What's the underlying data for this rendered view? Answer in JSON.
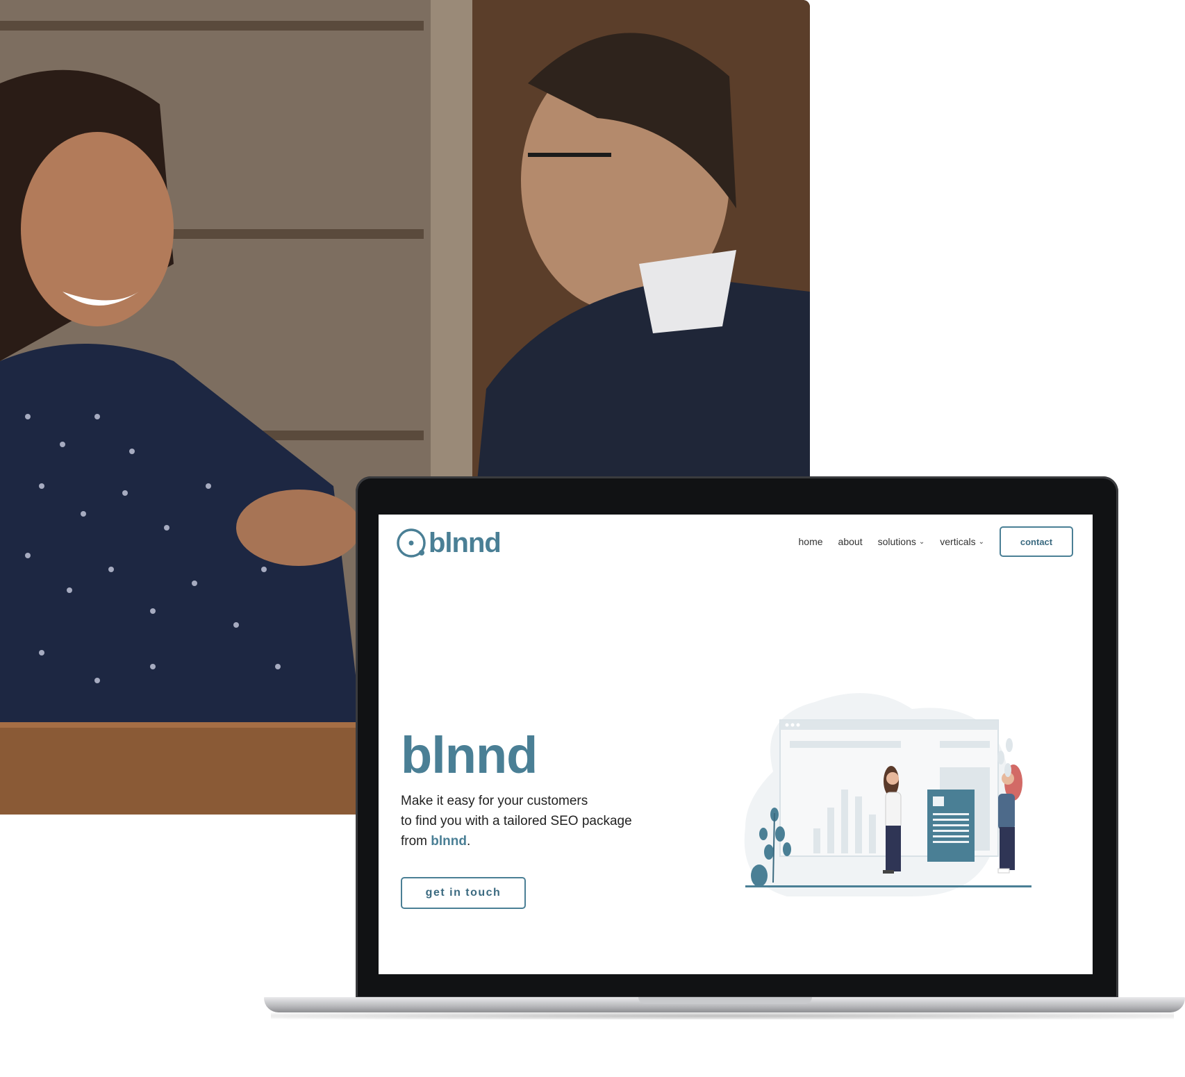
{
  "site": {
    "logo_text": "blnnd",
    "nav": [
      {
        "label": "home",
        "has_dropdown": false
      },
      {
        "label": "about",
        "has_dropdown": false
      },
      {
        "label": "solutions",
        "has_dropdown": true
      },
      {
        "label": "verticals",
        "has_dropdown": true
      }
    ],
    "contact_label": "contact"
  },
  "hero": {
    "title": "blnnd",
    "line1": "Make it easy for your customers",
    "line2": "to find you with a tailored SEO package",
    "line3_prefix": "from ",
    "line3_brand": "blnnd",
    "line3_suffix": ".",
    "cta_label": "get in touch"
  },
  "colors": {
    "brand": "#4a7f95",
    "text": "#222222"
  },
  "icons": {
    "dropdown": "chevron-down-icon",
    "logo": "blnnd-logo-mark-icon"
  }
}
